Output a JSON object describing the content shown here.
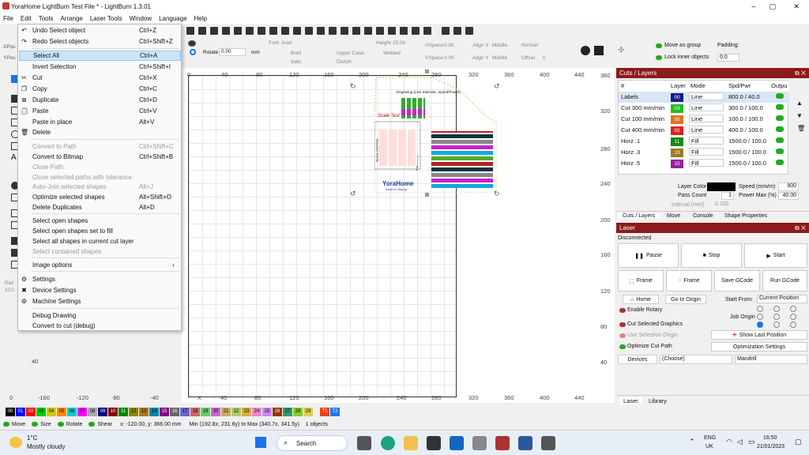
{
  "window": {
    "title": "YoraHome LightBurn Test File * - LightBurn 1.3.01",
    "minimize": "–",
    "maximize": "▢",
    "close": "✕"
  },
  "menubar": [
    "File",
    "Edit",
    "Tools",
    "Arrange",
    "Laser Tools",
    "Window",
    "Language",
    "Help"
  ],
  "edit_menu": [
    {
      "label": "Undo Select object",
      "shortcut": "Ctrl+Z",
      "enabled": true,
      "icon": "undo-icon"
    },
    {
      "label": "Redo Select objects",
      "shortcut": "Ctrl+Shift+Z",
      "enabled": true,
      "icon": "redo-icon"
    },
    {
      "label": "Select All",
      "shortcut": "Ctrl+A",
      "enabled": true,
      "selected": true
    },
    {
      "label": "Invert Selection",
      "shortcut": "Ctrl+Shift+I",
      "enabled": true
    },
    {
      "label": "Cut",
      "shortcut": "Ctrl+X",
      "enabled": true,
      "icon": "scissors-icon"
    },
    {
      "label": "Copy",
      "shortcut": "Ctrl+C",
      "enabled": true,
      "icon": "copy-icon"
    },
    {
      "label": "Duplicate",
      "shortcut": "Ctrl+D",
      "enabled": true,
      "icon": "duplicate-icon"
    },
    {
      "label": "Paste",
      "shortcut": "Ctrl+V",
      "enabled": true,
      "icon": "paste-icon"
    },
    {
      "label": "Paste in place",
      "shortcut": "Alt+V",
      "enabled": true
    },
    {
      "label": "Delete",
      "shortcut": "",
      "enabled": true,
      "icon": "trash-icon"
    },
    {
      "label": "Convert to Path",
      "shortcut": "Ctrl+Shift+C",
      "enabled": false
    },
    {
      "label": "Convert to Bitmap",
      "shortcut": "Ctrl+Shift+B",
      "enabled": true
    },
    {
      "label": "Close Path",
      "shortcut": "",
      "enabled": false
    },
    {
      "label": "Close selected paths with tolerance",
      "shortcut": "",
      "enabled": false
    },
    {
      "label": "Auto-Join selected shapes",
      "shortcut": "Alt+J",
      "enabled": false
    },
    {
      "label": "Optimize selected shapes",
      "shortcut": "Alt+Shift+O",
      "enabled": true
    },
    {
      "label": "Delete Duplicates",
      "shortcut": "Alt+D",
      "enabled": true
    },
    {
      "label": "Select open shapes",
      "shortcut": "",
      "enabled": true
    },
    {
      "label": "Select open shapes set to fill",
      "shortcut": "",
      "enabled": true
    },
    {
      "label": "Select all shapes in current cut layer",
      "shortcut": "",
      "enabled": true
    },
    {
      "label": "Select contained shapes",
      "shortcut": "",
      "enabled": false
    },
    {
      "label": "Image options",
      "shortcut": "›",
      "enabled": true
    },
    {
      "label": "Settings",
      "shortcut": "",
      "enabled": true,
      "icon": "gear-icon"
    },
    {
      "label": "Device Settings",
      "shortcut": "",
      "enabled": true,
      "icon": "wrench-icon"
    },
    {
      "label": "Machine Settings",
      "shortcut": "",
      "enabled": true,
      "icon": "gear-icon"
    },
    {
      "label": "Debug Drawing",
      "shortcut": "",
      "enabled": true
    },
    {
      "label": "Convert to cut (debug)",
      "shortcut": "",
      "enabled": true
    }
  ],
  "propbar": {
    "rotate_label": "Rotate",
    "rotate_value": "0.00",
    "mm": "mm",
    "font_label": "Font",
    "font_value": "Arial",
    "height_label": "Height",
    "height_value": "25.00",
    "hspace_label": "HSpace",
    "hspace_value": "0.00",
    "alignx_label": "Align X",
    "alignx_value": "Middle",
    "normal": "Normal",
    "bold": "Bold",
    "upper_case": "Upper Case",
    "welded": "Welded",
    "italic": "Italic",
    "distort": "Distort",
    "vspace_label": "VSpace",
    "vspace_value": "0.00",
    "aligny_label": "Align Y",
    "aligny_value": "Middle",
    "offset_label": "Offset",
    "offset_value": "0",
    "xpos": "XPos",
    "ypos": "YPos",
    "rad": "Rad",
    "rad_value": "10.0"
  },
  "groupopts": {
    "move_as_group": "Move as group",
    "lock_inner": "Lock inner objects",
    "padding_label": "Padding:",
    "padding_value": "0.0"
  },
  "rulers": {
    "top": [
      "0",
      "40",
      "80",
      "120",
      "160",
      "200",
      "240",
      "280",
      "320",
      "360",
      "400",
      "440"
    ],
    "bottom": [
      "0",
      "-160",
      "-120",
      "-80",
      "-40",
      "X",
      "40",
      "80",
      "120",
      "160",
      "200",
      "240",
      "280",
      "320",
      "360",
      "400",
      "440"
    ],
    "right": [
      "360",
      "320",
      "280",
      "240",
      "200",
      "160",
      "120",
      "80",
      "40"
    ],
    "left_bottom": "40"
  },
  "design": {
    "title": "Engraving (Line Intervals, Speed/Power)",
    "script_text": "Scale Test",
    "brand": "YoraHome",
    "brand_sub": "Smart for Making",
    "side_label": "Speed (mm/min)",
    "power_label": "Power (%)"
  },
  "cuts_panel": {
    "title": "Cuts / Layers",
    "headers": [
      "#",
      "Layer",
      "Mode",
      "Spd/Pwr",
      "Outpu"
    ],
    "rows": [
      {
        "name": "Labels",
        "layer": "00",
        "color": "#1a1a8a",
        "mode": "Line",
        "spdpwr": "800.0 / 40.0"
      },
      {
        "name": "Cut 300 mm/min",
        "layer": "03",
        "color": "#22bb22",
        "mode": "Line",
        "spdpwr": "300.0 / 100.0"
      },
      {
        "name": "Cut 100 mm/min",
        "layer": "05",
        "color": "#e07020",
        "mode": "Line",
        "spdpwr": "100.0 / 100.0"
      },
      {
        "name": "Cut 400 mm/min",
        "layer": "02",
        "color": "#e02020",
        "mode": "Line",
        "spdpwr": "400.0 / 100.0"
      },
      {
        "name": "Horz .1",
        "layer": "11",
        "color": "#118811",
        "mode": "Fill",
        "spdpwr": "1500.0 / 100.0"
      },
      {
        "name": "Horz .3",
        "layer": "13",
        "color": "#a07820",
        "mode": "Fill",
        "spdpwr": "1500.0 / 100.0"
      },
      {
        "name": "Horz .5",
        "layer": "15",
        "color": "#9a209a",
        "mode": "Fill",
        "spdpwr": "1500.0 / 100.0"
      }
    ],
    "layer_color_label": "Layer Color",
    "speed_label": "Speed (mm/m)",
    "speed_value": "800",
    "pass_count_label": "Pass Count",
    "pass_count_value": "1",
    "power_max_label": "Power Max (%)",
    "power_max_value": "40.00",
    "interval_label": "Interval (mm)",
    "interval_value": "0.100"
  },
  "panel_tabs": [
    "Cuts / Layers",
    "Move",
    "Console",
    "Shape Properties"
  ],
  "laser": {
    "title": "Laser",
    "status": "Disconnected",
    "pause": "Pause",
    "stop": "Stop",
    "start": "Start",
    "frame1": "Frame",
    "frame2": "Frame",
    "save_gcode": "Save GCode",
    "run_gcode": "Run GCode",
    "home": "Home",
    "go_to_origin": "Go to Origin",
    "start_from_label": "Start From:",
    "start_from_value": "Current Position",
    "enable_rotary": "Enable Rotary",
    "job_origin": "Job Origin",
    "cut_selected": "Cut Selected Graphics",
    "use_selection_origin": "Use Selection Origin",
    "show_last_position": "Show Last Position",
    "optimize_cut_path": "Optimize Cut Path",
    "optimization_settings": "Optimization Settings",
    "devices": "Devices",
    "device_value": "(Choose)",
    "machine": "Mandrill"
  },
  "bottom_tabs": [
    "Laser",
    "Library"
  ],
  "palette": [
    {
      "label": "00",
      "color": "#000000"
    },
    {
      "label": "01",
      "color": "#0000ff"
    },
    {
      "label": "02",
      "color": "#ff0000"
    },
    {
      "label": "03",
      "color": "#00cc00"
    },
    {
      "label": "04",
      "color": "#cccc00"
    },
    {
      "label": "05",
      "color": "#ff8800"
    },
    {
      "label": "06",
      "color": "#00cccc"
    },
    {
      "label": "07",
      "color": "#ff00ff"
    },
    {
      "label": "08",
      "color": "#aaaaaa"
    },
    {
      "label": "09",
      "color": "#000088"
    },
    {
      "label": "10",
      "color": "#880000"
    },
    {
      "label": "11",
      "color": "#008800"
    },
    {
      "label": "12",
      "color": "#888800"
    },
    {
      "label": "13",
      "color": "#aa7722"
    },
    {
      "label": "14",
      "color": "#0088aa"
    },
    {
      "label": "15",
      "color": "#880088"
    },
    {
      "label": "16",
      "color": "#666666"
    },
    {
      "label": "17",
      "color": "#6666cc"
    },
    {
      "label": "18",
      "color": "#cc6666"
    },
    {
      "label": "19",
      "color": "#66cc66"
    },
    {
      "label": "20",
      "color": "#cc66cc"
    },
    {
      "label": "21",
      "color": "#ccaa66"
    },
    {
      "label": "22",
      "color": "#aacc66"
    },
    {
      "label": "23",
      "color": "#ddaa44"
    },
    {
      "label": "24",
      "color": "#ee88cc"
    },
    {
      "label": "25",
      "color": "#cc88ee"
    },
    {
      "label": "26",
      "color": "#993300"
    },
    {
      "label": "27",
      "color": "#339966"
    },
    {
      "label": "28",
      "color": "#88cc22"
    },
    {
      "label": "29",
      "color": "#ddcc55"
    },
    {
      "label": "T1",
      "color": "#ee4411"
    },
    {
      "label": "T2",
      "color": "#2277ee"
    }
  ],
  "status": {
    "move": "Move",
    "size": "Size",
    "rotate": "Rotate",
    "shear": "Shear",
    "coords": "x: -120.00, y: 366.00 mm",
    "minmax": "Min (192.8x, 231.6y) to Max (340.7x, 341.5y)",
    "objects": "1 objects"
  },
  "taskbar": {
    "temp": "1°C",
    "weather": "Mostly cloudy",
    "search": "Search",
    "lang1": "ENG",
    "lang2": "UK",
    "time": "16:50",
    "date": "21/01/2023"
  }
}
